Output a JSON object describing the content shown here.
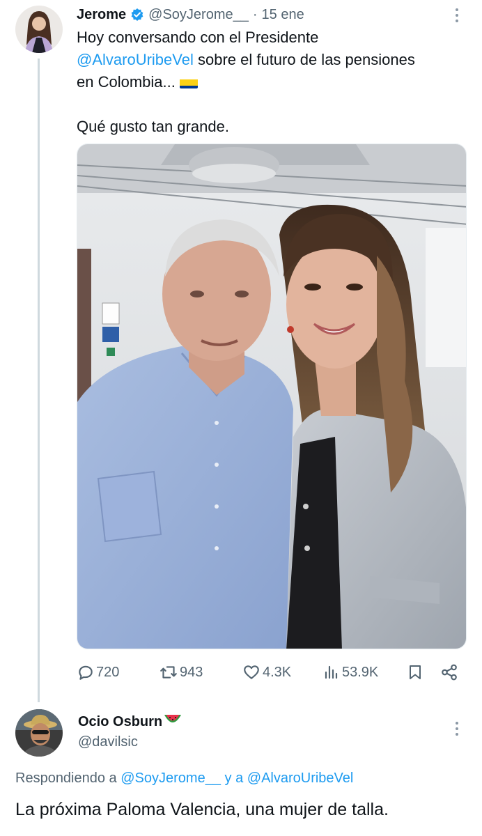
{
  "tweet": {
    "author_name": "Jerome",
    "author_handle": "@SoyJerome__",
    "dot": "·",
    "time": "15 ene",
    "text_line1": "Hoy conversando con el Presidente",
    "text_mention": "@AlvaroUribeVel",
    "text_line2_rest": " sobre el futuro de las pensiones",
    "text_line3": "en Colombia...",
    "flag_icon": "colombia-flag-icon",
    "text_line5": "Qué gusto tan grande.",
    "stats": {
      "replies": "720",
      "retweets": "943",
      "likes": "4.3K",
      "views": "53.9K"
    },
    "icons": {
      "verified": "verified-badge-icon",
      "reply": "reply-icon",
      "retweet": "retweet-icon",
      "like": "heart-icon",
      "views": "views-icon",
      "bookmark": "bookmark-icon",
      "share": "share-icon",
      "more": "more-options-icon"
    }
  },
  "reply": {
    "author_name": "Ocio Osburn",
    "author_emoji_icon": "watermelon-icon",
    "author_handle": "@davilsic",
    "replying_prefix": "Respondiendo a",
    "replying_to_1": "@SoyJerome__",
    "replying_conj": "y a",
    "replying_to_2": "@AlvaroUribeVel",
    "text": "La próxima Paloma Valencia, una mujer de talla."
  },
  "colors": {
    "link": "#1d9bf0",
    "secondary_text": "#536471",
    "primary_text": "#0f1419",
    "thread_line": "#cfd9de",
    "verified": "#1d9bf0"
  }
}
